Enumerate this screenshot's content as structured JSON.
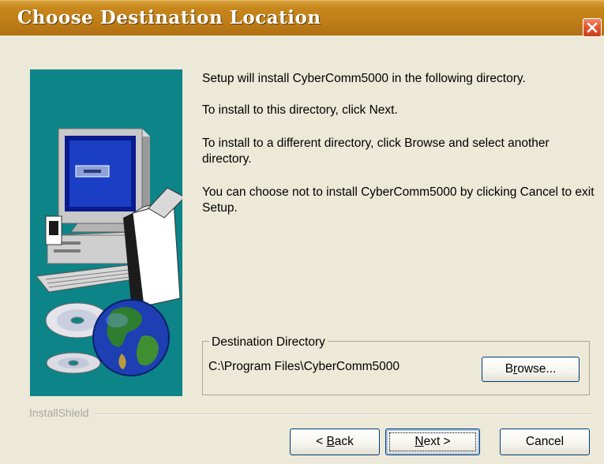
{
  "window": {
    "title": "Choose Destination Location"
  },
  "content": {
    "line1": "Setup will install CyberComm5000 in the following directory.",
    "line2": "To install to this directory, click Next.",
    "line3": "To install to a different directory, click Browse and select another directory.",
    "line4": "You can choose not to install CyberComm5000 by clicking Cancel to exit Setup."
  },
  "destination": {
    "group_label": "Destination Directory",
    "path": "C:\\Program Files\\CyberComm5000",
    "browse_label": "Browse...",
    "browse_mnemonic_pre": "B",
    "browse_mnemonic": "r",
    "browse_mnemonic_post": "owse..."
  },
  "footer": {
    "brand": "InstallShield",
    "back_pre": "< ",
    "back_mnemonic": "B",
    "back_post": "ack",
    "next_mnemonic": "N",
    "next_post": "ext >",
    "cancel_label": "Cancel"
  },
  "colors": {
    "title_bar": "#c07f18",
    "art_background": "#0d8488",
    "close_button": "#e2552e"
  },
  "icons": {
    "close": "close-icon",
    "artwork": [
      "computer-icon",
      "cd-icon",
      "globe-icon"
    ]
  }
}
